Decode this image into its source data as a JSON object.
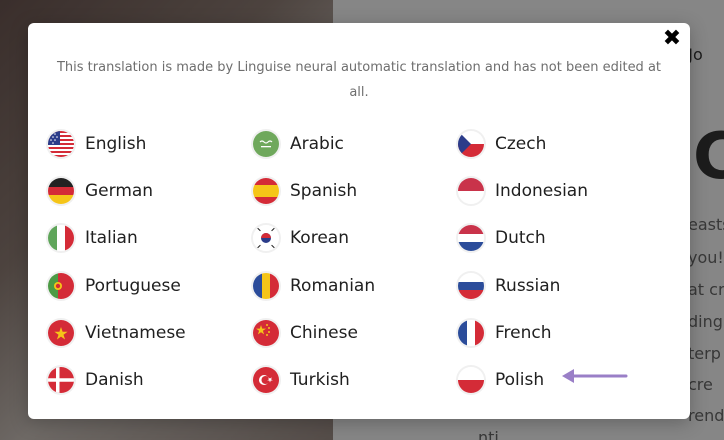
{
  "background": {
    "fragments": [
      "n Jo",
      "C",
      "easts",
      "you!",
      "at cr",
      "ding",
      "terp",
      "cre",
      "rend",
      "nti..."
    ]
  },
  "modal": {
    "close_label": "✖",
    "notice": "This translation is made by Linguise neural automatic translation and has not been edited at all."
  },
  "languages": [
    {
      "label": "English",
      "flag": "us-flag-icon"
    },
    {
      "label": "Arabic",
      "flag": "arabic-flag-icon"
    },
    {
      "label": "Czech",
      "flag": "czech-flag-icon"
    },
    {
      "label": "German",
      "flag": "germany-flag-icon"
    },
    {
      "label": "Spanish",
      "flag": "spain-flag-icon"
    },
    {
      "label": "Indonesian",
      "flag": "indonesia-flag-icon"
    },
    {
      "label": "Italian",
      "flag": "italy-flag-icon"
    },
    {
      "label": "Korean",
      "flag": "korea-flag-icon"
    },
    {
      "label": "Dutch",
      "flag": "netherlands-flag-icon"
    },
    {
      "label": "Portuguese",
      "flag": "portugal-flag-icon"
    },
    {
      "label": "Romanian",
      "flag": "romania-flag-icon"
    },
    {
      "label": "Russian",
      "flag": "russia-flag-icon"
    },
    {
      "label": "Vietnamese",
      "flag": "vietnam-flag-icon"
    },
    {
      "label": "Chinese",
      "flag": "china-flag-icon"
    },
    {
      "label": "French",
      "flag": "france-flag-icon"
    },
    {
      "label": "Danish",
      "flag": "denmark-flag-icon"
    },
    {
      "label": "Turkish",
      "flag": "turkey-flag-icon"
    },
    {
      "label": "Polish",
      "flag": "poland-flag-icon"
    }
  ],
  "annotation": {
    "color": "#9a7fc7",
    "icon": "arrow-left-icon"
  }
}
